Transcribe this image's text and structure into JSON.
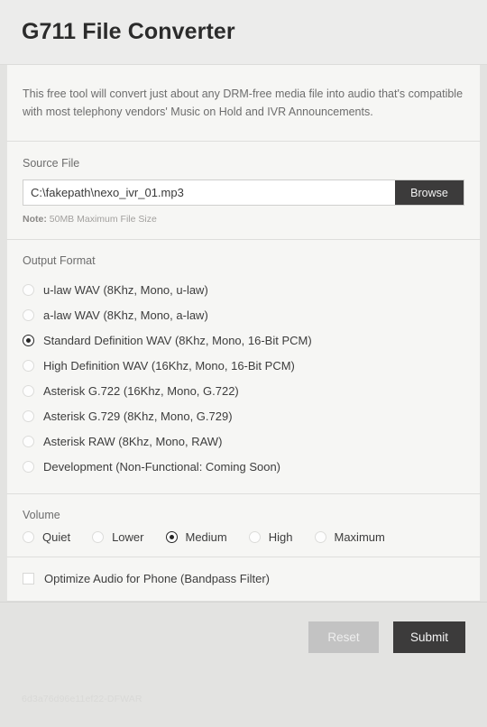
{
  "header": {
    "title": "G711 File Converter"
  },
  "intro": {
    "text": "This free tool will convert just about any DRM-free media file into audio that's compatible with most telephony vendors' Music on Hold and IVR Announcements."
  },
  "source_file": {
    "label": "Source File",
    "value": "C:\\fakepath\\nexo_ivr_01.mp3",
    "placeholder": "",
    "browse_label": "Browse",
    "note_prefix": "Note:",
    "note_text": " 50MB Maximum File Size"
  },
  "output_format": {
    "label": "Output Format",
    "selected_index": 2,
    "options": [
      {
        "label": "u-law WAV (8Khz, Mono, u-law)",
        "selected": false
      },
      {
        "label": "a-law WAV (8Khz, Mono, a-law)",
        "selected": false
      },
      {
        "label": "Standard Definition WAV (8Khz, Mono, 16-Bit PCM)",
        "selected": true
      },
      {
        "label": "High Definition WAV (16Khz, Mono, 16-Bit PCM)",
        "selected": false
      },
      {
        "label": "Asterisk G.722 (16Khz, Mono, G.722)",
        "selected": false
      },
      {
        "label": "Asterisk G.729 (8Khz, Mono, G.729)",
        "selected": false
      },
      {
        "label": "Asterisk RAW (8Khz, Mono, RAW)",
        "selected": false
      },
      {
        "label": "Development (Non-Functional: Coming Soon)",
        "selected": false
      }
    ]
  },
  "volume": {
    "label": "Volume",
    "selected_index": 2,
    "options": [
      {
        "label": "Quiet",
        "selected": false
      },
      {
        "label": "Lower",
        "selected": false
      },
      {
        "label": "Medium",
        "selected": true
      },
      {
        "label": "High",
        "selected": false
      },
      {
        "label": "Maximum",
        "selected": false
      }
    ]
  },
  "optimize": {
    "label": "Optimize Audio for Phone (Bandpass Filter)",
    "checked": false
  },
  "footer": {
    "reset_label": "Reset",
    "submit_label": "Submit",
    "watermark": "6d3a76d96e11ef22-DFWAR"
  },
  "colors": {
    "header_bg": "#ececeb",
    "panel_bg": "#f6f6f4",
    "page_bg": "#e3e3e1",
    "dark_button": "#3c3b3b",
    "reset_button": "#c3c3c3",
    "label_text": "#6d6d6d",
    "body_text": "#3d3d3d"
  }
}
